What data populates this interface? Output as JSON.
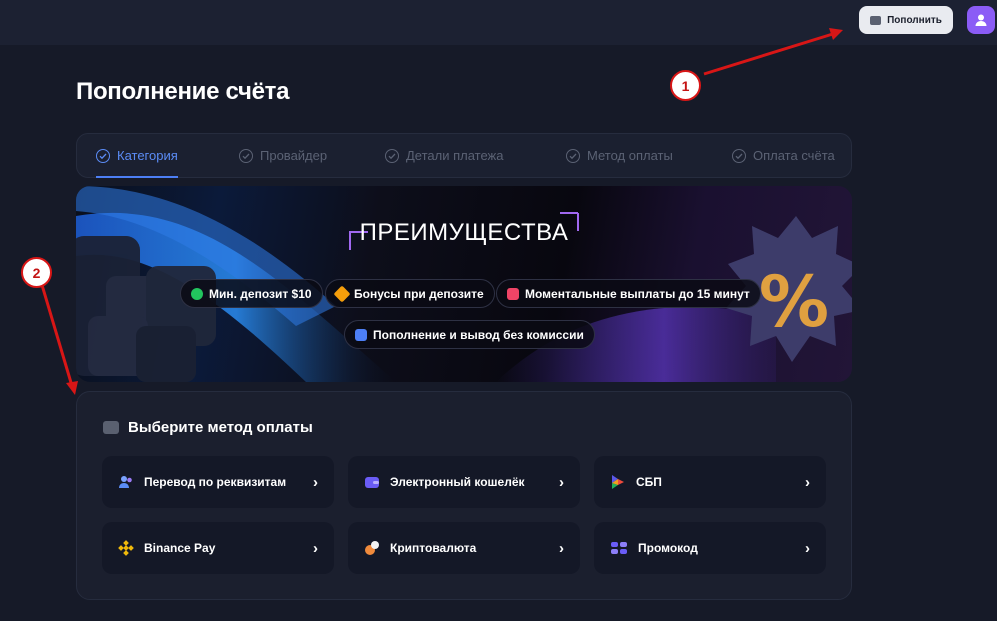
{
  "header": {
    "topup_label": "Пополнить",
    "avatar_icon": "user-icon"
  },
  "page": {
    "title": "Пополнение счёта"
  },
  "steps": [
    {
      "label": "Категория",
      "active": true
    },
    {
      "label": "Провайдер",
      "active": false
    },
    {
      "label": "Детали платежа",
      "active": false
    },
    {
      "label": "Метод оплаты",
      "active": false
    },
    {
      "label": "Оплата счёта",
      "active": false
    }
  ],
  "banner": {
    "title": "ПРЕИМУЩЕСТВА",
    "pills": [
      {
        "label": "Мин. депозит $10",
        "icon": "dollar-coin-icon",
        "color": "#22c55e"
      },
      {
        "label": "Бонусы при депозите",
        "icon": "star-burst-icon",
        "color": "#f59e0b"
      },
      {
        "label": "Моментальные выплаты до 15 минут",
        "icon": "timer-icon",
        "color": "#ef4466"
      },
      {
        "label": "Пополнение и вывод без комиссии",
        "icon": "thumbs-up-icon",
        "color": "#4d7ff5"
      }
    ]
  },
  "methods": {
    "heading": "Выберите метод оплаты",
    "items": [
      {
        "label": "Перевод по реквизитам",
        "icon": "users-icon"
      },
      {
        "label": "Электронный кошелёк",
        "icon": "wallet-icon"
      },
      {
        "label": "СБП",
        "icon": "sbp-icon"
      },
      {
        "label": "Binance Pay",
        "icon": "binance-icon"
      },
      {
        "label": "Криптовалюта",
        "icon": "crypto-coin-icon"
      },
      {
        "label": "Промокод",
        "icon": "promo-icon"
      }
    ]
  },
  "annotations": {
    "one": "1",
    "two": "2",
    "color": "#d81616"
  },
  "colors": {
    "accent": "#4d7ff5",
    "avatar": "#8b5cf6",
    "background": "#161a28"
  }
}
